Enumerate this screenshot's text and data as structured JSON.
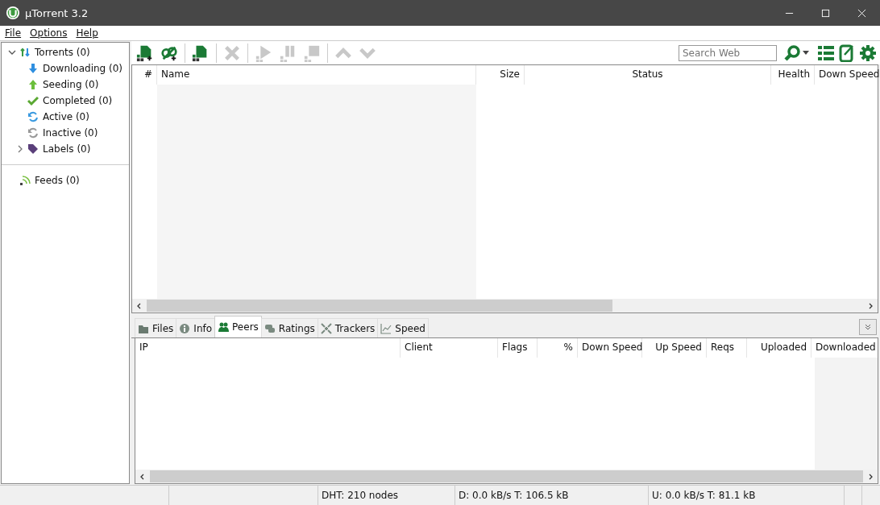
{
  "window": {
    "title": "µTorrent 3.2"
  },
  "menu": [
    "File",
    "Options",
    "Help"
  ],
  "sidebar": {
    "tree": [
      {
        "label": "Torrents (0)",
        "kind": "torrents",
        "expanded": true,
        "children": [
          {
            "label": "Downloading (0)",
            "kind": "down"
          },
          {
            "label": "Seeding (0)",
            "kind": "up"
          },
          {
            "label": "Completed (0)",
            "kind": "done"
          },
          {
            "label": "Active (0)",
            "kind": "active"
          },
          {
            "label": "Inactive (0)",
            "kind": "inactive"
          },
          {
            "label": "Labels (0)",
            "kind": "label",
            "expanded": false
          }
        ]
      }
    ],
    "feeds": {
      "label": "Feeds (0)"
    }
  },
  "toolbar": {
    "buttons": [
      {
        "kind": "add",
        "disabled": false
      },
      {
        "kind": "addlink",
        "disabled": false
      },
      {
        "kind": "create",
        "disabled": false
      },
      {
        "kind": "remove",
        "disabled": true
      },
      {
        "kind": "start",
        "disabled": true
      },
      {
        "kind": "pause",
        "disabled": true
      },
      {
        "kind": "stop",
        "disabled": true
      },
      {
        "kind": "moveup",
        "disabled": true
      },
      {
        "kind": "movedown",
        "disabled": true
      }
    ],
    "search": {
      "placeholder": "Search Web"
    }
  },
  "torrents": {
    "columns": [
      "#",
      "Name",
      "Size",
      "Status",
      "Health",
      "Down Speed"
    ]
  },
  "detail_tabs": [
    {
      "label": "Files",
      "kind": "files",
      "selected": false
    },
    {
      "label": "Info",
      "kind": "info",
      "selected": false
    },
    {
      "label": "Peers",
      "kind": "peers",
      "selected": true
    },
    {
      "label": "Ratings",
      "kind": "ratings",
      "selected": false
    },
    {
      "label": "Trackers",
      "kind": "trackers",
      "selected": false
    },
    {
      "label": "Speed",
      "kind": "speed",
      "selected": false
    }
  ],
  "peers": {
    "columns": [
      "IP",
      "Client",
      "Flags",
      "%",
      "Down Speed",
      "Up Speed",
      "Reqs",
      "Uploaded",
      "Downloaded"
    ]
  },
  "status_bar": [
    "DHT: 210 nodes",
    "D: 0.0 kB/s T: 106.5 kB",
    "U: 0.0 kB/s T: 81.1 kB"
  ]
}
